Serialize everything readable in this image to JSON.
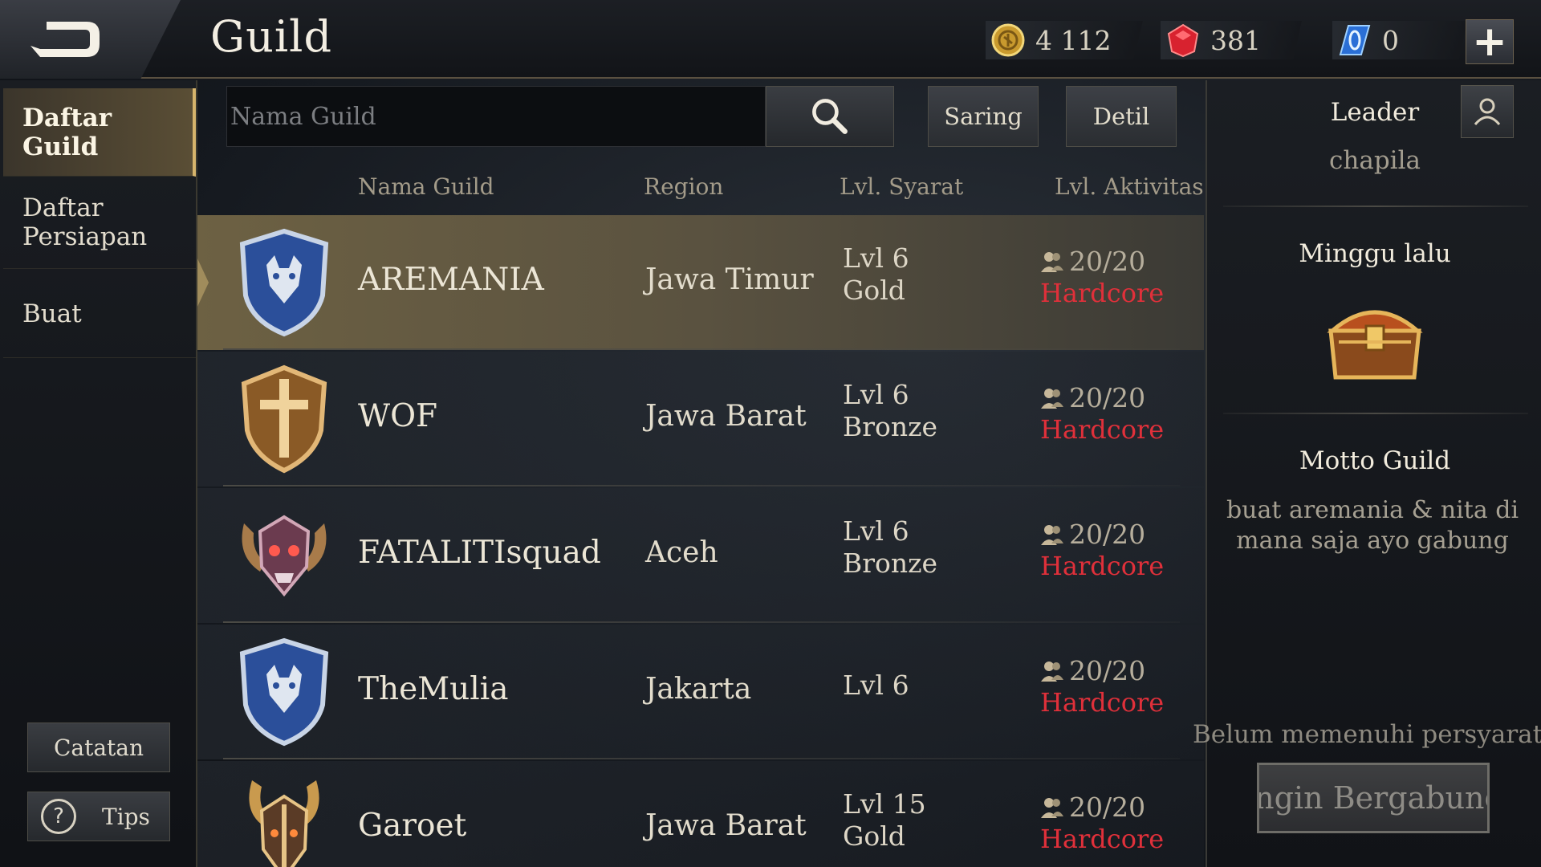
{
  "header": {
    "title": "Guild",
    "currencies": [
      {
        "icon": "gold-coin-icon",
        "value": "4 112"
      },
      {
        "icon": "ruby-icon",
        "value": "381"
      },
      {
        "icon": "blue-gem-icon",
        "value": "0"
      }
    ],
    "add_label": "+"
  },
  "nav": {
    "items": [
      "Daftar Guild",
      "Daftar Persiapan",
      "Buat"
    ],
    "active": "Daftar Guild",
    "catatan": "Catatan",
    "tips": "Tips",
    "tips_icon_glyph": "?"
  },
  "search": {
    "placeholder": "Nama Guild",
    "value": "",
    "saring": "Saring",
    "detil": "Detil"
  },
  "table": {
    "columns": [
      "Nama Guild",
      "Region",
      "Lvl. Syarat",
      "Lvl. Aktivitas"
    ],
    "rows": [
      {
        "emblem": "blue-wolf-shield-icon",
        "name": "AREMANIA",
        "region": "Jawa Timur",
        "lvl": "Lvl 6",
        "tier": "Gold",
        "members": "20/20",
        "activity": "Hardcore",
        "selected": true
      },
      {
        "emblem": "bronze-sword-shield-icon",
        "name": "WOF",
        "region": "Jawa Barat",
        "lvl": "Lvl 6",
        "tier": "Bronze",
        "members": "20/20",
        "activity": "Hardcore",
        "selected": false
      },
      {
        "emblem": "horned-skull-emblem-icon",
        "name": "FATALITIsquad",
        "region": "Aceh",
        "lvl": "Lvl 6",
        "tier": "Bronze",
        "members": "20/20",
        "activity": "Hardcore",
        "selected": false
      },
      {
        "emblem": "blue-wolf-shield-icon",
        "name": "TheMulia",
        "region": "Jakarta",
        "lvl": "Lvl 6",
        "tier": "",
        "members": "20/20",
        "activity": "Hardcore",
        "selected": false
      },
      {
        "emblem": "golden-horned-helm-icon",
        "name": "Garoet",
        "region": "Jawa Barat",
        "lvl": "Lvl 15",
        "tier": "Gold",
        "members": "20/20",
        "activity": "Hardcore",
        "selected": false
      }
    ]
  },
  "detail": {
    "leader_label": "Leader",
    "leader_name": "chapila",
    "last_week_label": "Minggu lalu",
    "reward_icon": "treasure-chest-icon",
    "motto_label": "Motto Guild",
    "motto": "buat aremania & nita di mana saja ayo gabung",
    "requirement_text": "Belum memenuhi persyaratan",
    "join_label": "Ingin Bergabung"
  },
  "colors": {
    "accent_gold": "#d6b46c",
    "activity_red": "#e0303a",
    "selected_row": "#6d6143"
  }
}
